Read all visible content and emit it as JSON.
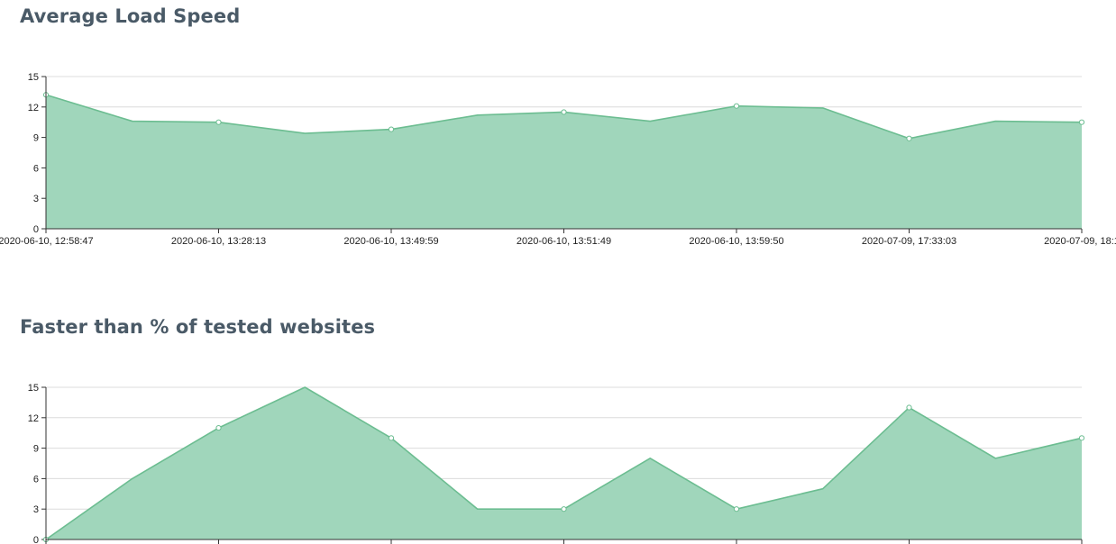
{
  "chart_data": [
    {
      "type": "area",
      "title": "Average Load Speed",
      "xlabel": "",
      "ylabel": "",
      "ylim": [
        0,
        15
      ],
      "yticks": [
        0,
        3,
        6,
        9,
        12,
        15
      ],
      "categories": [
        "2020-06-10, 12:58:47",
        "",
        "2020-06-10, 13:28:13",
        "",
        "2020-06-10, 13:49:59",
        "",
        "2020-06-10, 13:51:49",
        "",
        "2020-06-10, 13:59:50",
        "",
        "2020-07-09, 17:33:03",
        "",
        "2020-07-09, 18:1"
      ],
      "series": [
        {
          "values": [
            13.2,
            10.6,
            10.5,
            9.4,
            9.8,
            11.2,
            11.5,
            10.6,
            12.1,
            11.9,
            8.9,
            10.6,
            10.5
          ]
        }
      ],
      "grid": true,
      "legend": "none",
      "colors": {
        "fill": "#a0d6bb",
        "line": "#6cbd91",
        "point_fill": "#ffffff"
      }
    },
    {
      "type": "area",
      "title": "Faster than % of tested websites",
      "xlabel": "",
      "ylabel": "",
      "ylim": [
        0,
        15
      ],
      "yticks": [
        0,
        3,
        6,
        9,
        12,
        15
      ],
      "categories": [
        "",
        "",
        "",
        "",
        "",
        "",
        "",
        "",
        "",
        "",
        "",
        "",
        ""
      ],
      "series": [
        {
          "values": [
            0,
            6,
            11,
            15,
            10,
            3,
            3,
            8,
            3,
            5,
            13,
            8,
            10
          ]
        }
      ],
      "grid": true,
      "legend": "none",
      "colors": {
        "fill": "#a0d6bb",
        "line": "#6cbd91",
        "point_fill": "#ffffff"
      }
    }
  ]
}
